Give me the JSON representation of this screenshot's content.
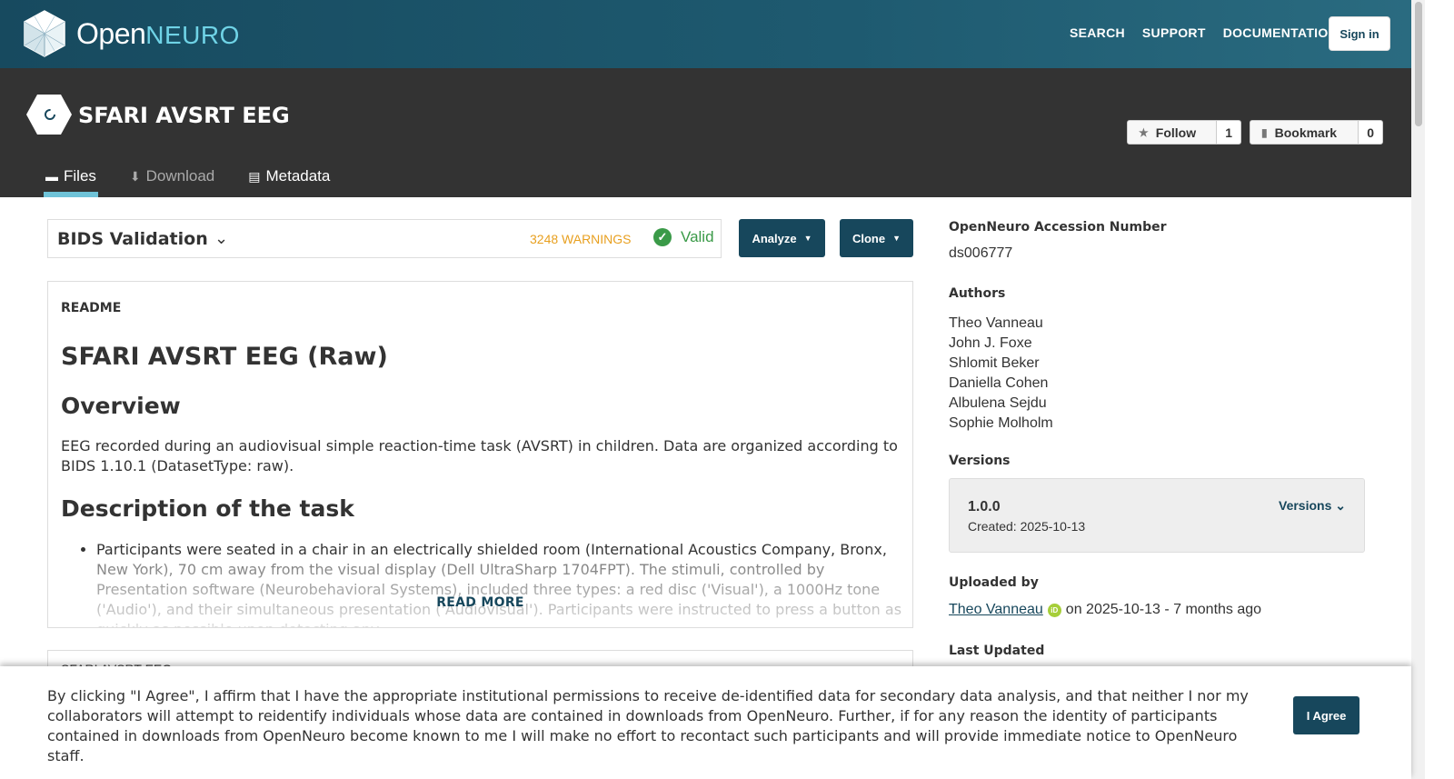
{
  "nav": {
    "logo_open": "Open",
    "logo_neuro": "NEURO",
    "links": [
      "SEARCH",
      "SUPPORT",
      "DOCUMENTATION"
    ],
    "signin": "Sign in"
  },
  "dataset": {
    "title": "SFARI AVSRT EEG",
    "follow_label": "Follow",
    "follow_count": "1",
    "bookmark_label": "Bookmark",
    "bookmark_count": "0",
    "tabs": [
      {
        "label": "Files",
        "icon": "folder-icon"
      },
      {
        "label": "Download",
        "icon": "download-icon"
      },
      {
        "label": "Metadata",
        "icon": "file-code-icon"
      }
    ]
  },
  "validation": {
    "title": "BIDS Validation",
    "warnings": "3248 WARNINGS",
    "status": "Valid",
    "analyze": "Analyze",
    "clone": "Clone"
  },
  "readme": {
    "label": "README",
    "h1": "SFARI AVSRT EEG (Raw)",
    "overview_h": "Overview",
    "overview_text": "EEG recorded during an audiovisual simple reaction-time task (AVSRT) in children. Data are organized according to BIDS 1.10.1 (DatasetType: raw).",
    "task_h": "Description of the task",
    "task_item": "Participants were seated in a chair in an electrically shielded room (International Acoustics Company, Bronx, New York), 70 cm away from the visual display (Dell UltraSharp 1704FPT). The stimuli, controlled by Presentation software (Neurobehavioral Systems), included three types: a red disc ('Visual'), a 1000Hz tone ('Audio'), and their simultaneous presentation ('Audiovisual'). Participants were instructed to press a button as quickly as possible upon detecting any",
    "read_more": "READ MORE",
    "filetree_label": "SFARI AVSRT EEG"
  },
  "sidebar": {
    "accession_h": "OpenNeuro Accession Number",
    "accession_v": "ds006777",
    "authors_h": "Authors",
    "authors": [
      "Theo Vanneau",
      "John J. Foxe",
      "Shlomit Beker",
      "Daniella Cohen",
      "Albulena Sejdu",
      "Sophie Molholm"
    ],
    "versions_h": "Versions",
    "version_num": "1.0.0",
    "version_created": "Created: 2025-10-13",
    "versions_btn": "Versions",
    "uploaded_h": "Uploaded by",
    "uploaded_name": "Theo Vanneau",
    "uploaded_rest": "on 2025-10-13 - 7 months ago",
    "last_updated_h": "Last Updated"
  },
  "consent": {
    "text": "By clicking \"I Agree\", I affirm that I have the appropriate institutional permissions to receive de-identified data for secondary data analysis, and that neither I nor my collaborators will attempt to reidentify individuals whose data are contained in downloads from OpenNeuro. Further, if for any reason the identity of participants contained in downloads from OpenNeuro become known to me I will make no effort to recontact such participants and will provide immediate notice to OpenNeuro staff.",
    "agree": "I Agree"
  }
}
